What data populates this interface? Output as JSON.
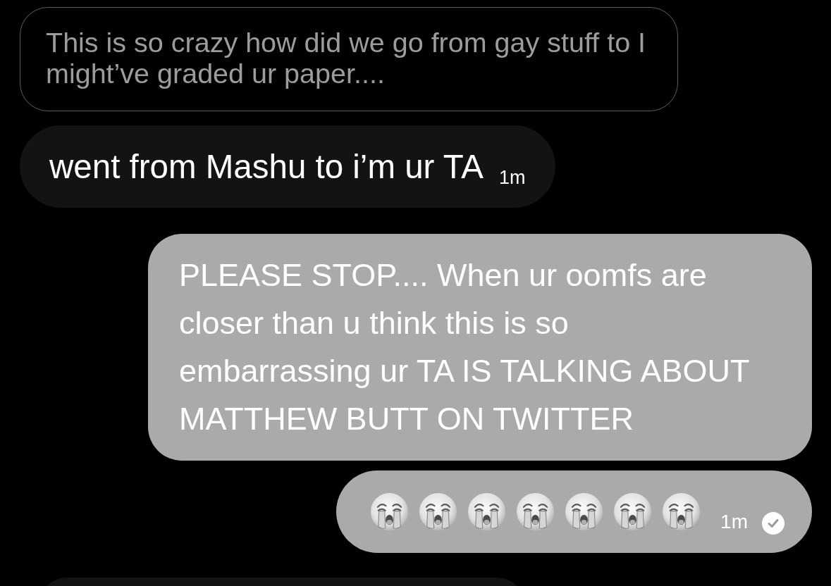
{
  "messages": [
    {
      "kind": "quoted",
      "text": "This is so crazy how did we go from gay stuff to I might’ve graded ur paper...."
    },
    {
      "kind": "received",
      "text": "went from Mashu to i’m ur TA",
      "time": "1m"
    },
    {
      "kind": "sent",
      "text": "PLEASE STOP.... When ur oomfs are closer than u think this is so embarrassing ur TA IS TALKING ABOUT MATTHEW BUTT ON TWITTER"
    },
    {
      "kind": "sent_emoji",
      "emojis": [
        {
          "kind": "loudly_crying"
        },
        {
          "kind": "loudly_crying"
        },
        {
          "kind": "loudly_crying"
        },
        {
          "kind": "loudly_crying"
        },
        {
          "kind": "loudly_crying"
        },
        {
          "kind": "loudly_crying"
        },
        {
          "kind": "loudly_crying"
        }
      ],
      "time": "1m",
      "seen": true
    }
  ]
}
